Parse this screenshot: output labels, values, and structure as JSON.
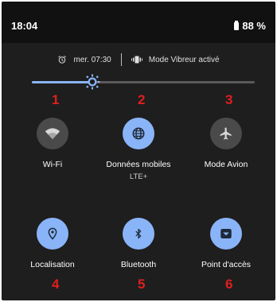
{
  "status_bar": {
    "time": "18:04",
    "battery": "88 %"
  },
  "info_row": {
    "alarm": "mer. 07:30",
    "mode": "Mode Vibreur activé"
  },
  "brightness": {
    "level": 0.27
  },
  "annotations": [
    "1",
    "2",
    "3",
    "4",
    "5",
    "6"
  ],
  "tiles": [
    {
      "label": "Wi-Fi",
      "sub": "",
      "state": "off",
      "icon": "wifi-icon"
    },
    {
      "label": "Données mobiles",
      "sub": "LTE+",
      "state": "on",
      "icon": "globe-icon"
    },
    {
      "label": "Mode Avion",
      "sub": "",
      "state": "off",
      "icon": "airplane-icon"
    },
    {
      "label": "Localisation",
      "sub": "",
      "state": "on",
      "icon": "location-icon"
    },
    {
      "label": "Bluetooth",
      "sub": "",
      "state": "on",
      "icon": "bluetooth-icon"
    },
    {
      "label": "Point d'accès",
      "sub": "",
      "state": "on",
      "icon": "hotspot-icon"
    }
  ],
  "colors": {
    "accent": "#8ab4f8",
    "tile_off": "#4a4a4a",
    "annotation": "#e11e1e",
    "background": "#1e1e1e"
  }
}
